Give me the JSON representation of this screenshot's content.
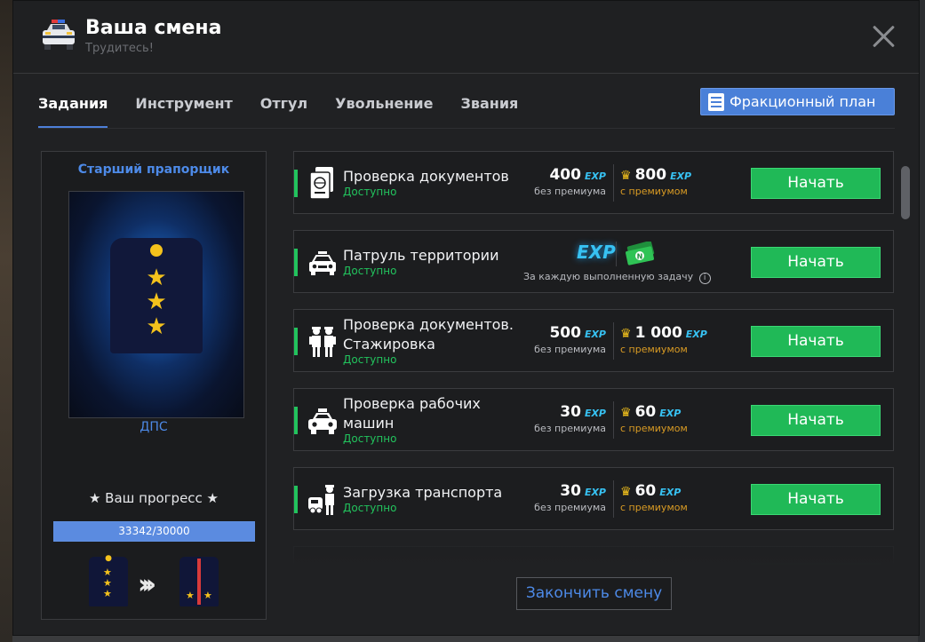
{
  "header": {
    "title": "Ваша смена",
    "subtitle": "Трудитесь!"
  },
  "tabs": [
    {
      "label": "Задания",
      "active": true
    },
    {
      "label": "Инструмент",
      "active": false
    },
    {
      "label": "Отгул",
      "active": false
    },
    {
      "label": "Увольнение",
      "active": false
    },
    {
      "label": "Звания",
      "active": false
    }
  ],
  "plan_button": "Фракционный план",
  "sidebar": {
    "rank": "Старший прапорщик",
    "department": "ДПС",
    "progress_label": "★ Ваш прогресс ★",
    "progress_text": "33342/30000",
    "progress_fraction": 1.0
  },
  "tasks": [
    {
      "name": "Проверка документов",
      "status": "Доступно",
      "reward": "400",
      "reward_premium": "800",
      "no_premium": "без премиума",
      "with_premium": "с премиумом",
      "action": "Начать",
      "icon": "passport-icon"
    },
    {
      "name": "Патруль территории",
      "status": "Доступно",
      "note": "За каждую выполненную задачу",
      "action": "Начать",
      "icon": "police-car-icon"
    },
    {
      "name": "Проверка документов. Стажировка",
      "name_l1": "Проверка документов.",
      "name_l2": "Стажировка",
      "status": "Доступно",
      "reward": "500",
      "reward_premium": "1 000",
      "no_premium": "без премиума",
      "with_premium": "с премиумом",
      "action": "Начать",
      "icon": "officers-icon"
    },
    {
      "name": "Проверка рабочих машин",
      "name_l1": "Проверка рабочих",
      "name_l2": "машин",
      "status": "Доступно",
      "reward": "30",
      "reward_premium": "60",
      "no_premium": "без премиума",
      "with_premium": "с премиумом",
      "action": "Начать",
      "icon": "taxi-icon"
    },
    {
      "name": "Загрузка транспорта",
      "status": "Доступно",
      "reward": "30",
      "reward_premium": "60",
      "no_premium": "без премиума",
      "with_premium": "с премиумом",
      "action": "Начать",
      "icon": "tow-officer-icon"
    }
  ],
  "exp_label": "EXP",
  "end_button": "Закончить смену",
  "colors": {
    "accent": "#4a80d8",
    "success": "#20b957",
    "exp": "#37c2f3",
    "premium": "#d99b24"
  }
}
